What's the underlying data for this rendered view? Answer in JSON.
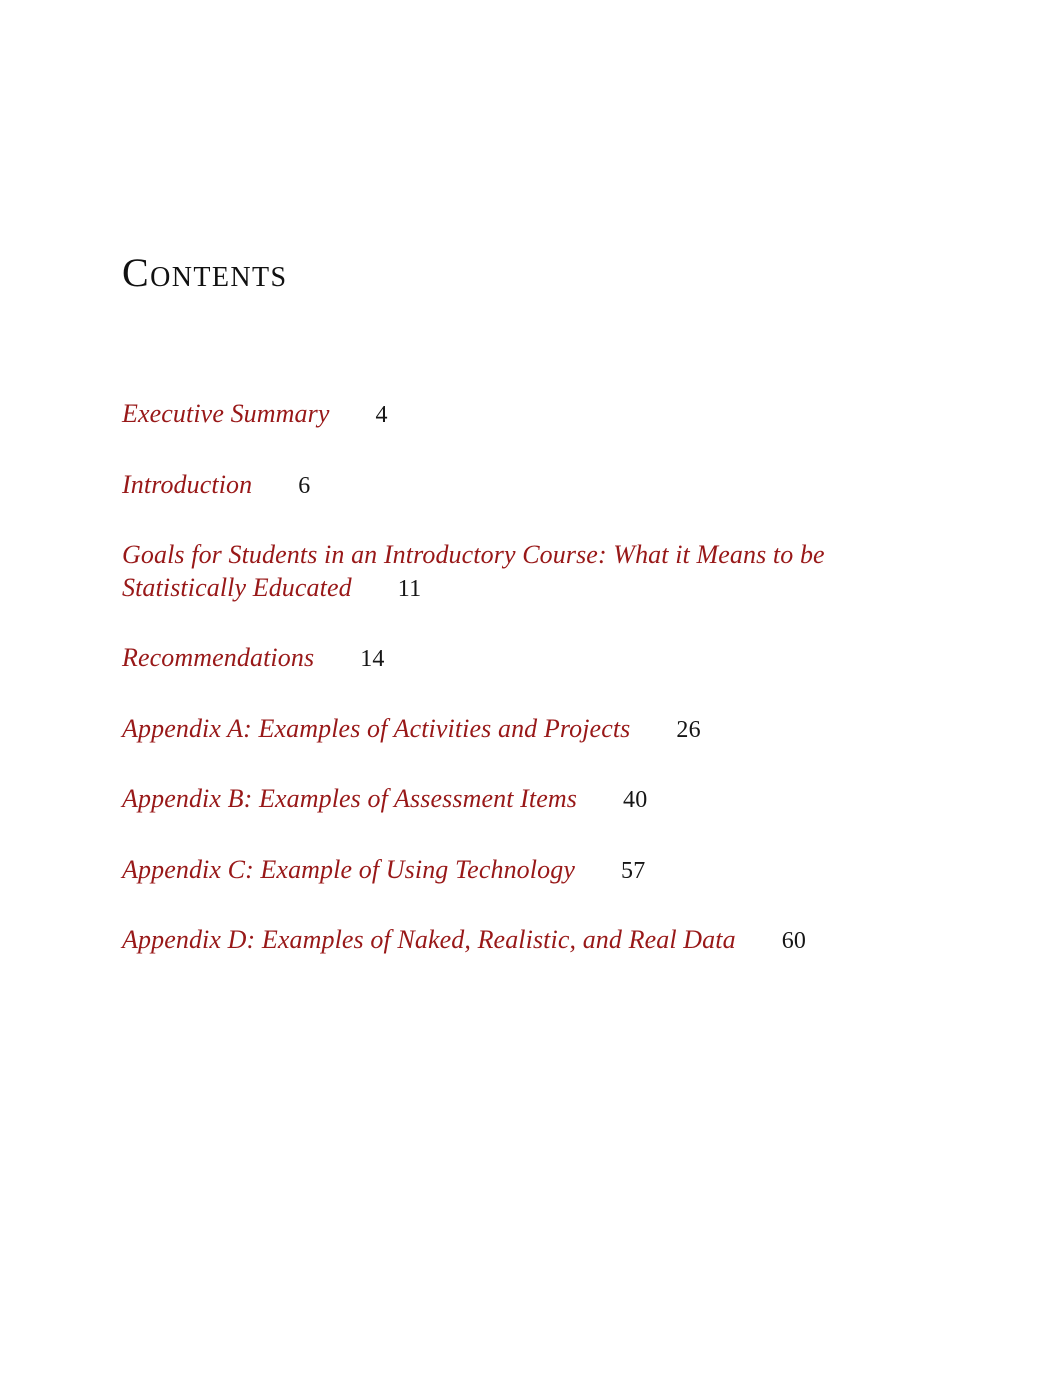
{
  "document": {
    "heading": "Contents",
    "text_color": "#111111",
    "entry_color": "#981818",
    "page_number_color": "#161616",
    "background": "#ffffff"
  },
  "toc": {
    "entries": [
      {
        "title": "Executive Summary",
        "page": "4"
      },
      {
        "title": "Introduction",
        "page": "6"
      },
      {
        "title": "Goals for Students in an Introductory Course: What it Means to be Statistically Educated",
        "page": "11"
      },
      {
        "title": "Recommendations",
        "page": "14"
      },
      {
        "title": "Appendix A: Examples of Activities and Projects",
        "page": "26"
      },
      {
        "title": "Appendix B: Examples of Assessment Items",
        "page": "40"
      },
      {
        "title": "Appendix C: Example of Using Technology",
        "page": "57"
      },
      {
        "title": "Appendix D: Examples of Naked, Realistic, and Real Data",
        "page": "60"
      }
    ]
  }
}
